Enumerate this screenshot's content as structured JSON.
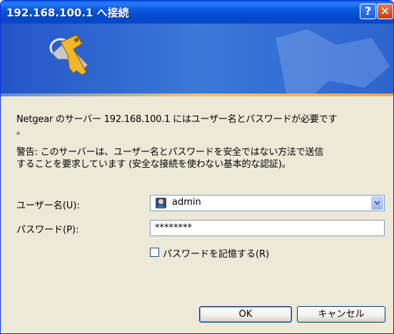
{
  "window": {
    "title": "192.168.100.1 へ接続",
    "help_glyph": "?",
    "close_glyph": "✕"
  },
  "banner": {
    "icon": "keys-icon",
    "accent_colors": [
      "#2455c8",
      "#f2c268"
    ]
  },
  "message": {
    "line1": "Netgear のサーバー 192.168.100.1 にはユーザー名とパスワードが必要です",
    "line1_tail": "。",
    "warning_line1": "警告: このサーバーは、ユーザー名とパスワードを安全ではない方法で送信",
    "warning_line2": "することを要求しています (安全な接続を使わない基本的な認証)。"
  },
  "form": {
    "username_label": "ユーザー名(U):",
    "username_value": "admin",
    "password_label": "パスワード(P):",
    "password_value": "********",
    "remember_label": "パスワードを記憶する(R)",
    "remember_checked": false
  },
  "buttons": {
    "ok": "OK",
    "cancel": "キャンセル"
  }
}
